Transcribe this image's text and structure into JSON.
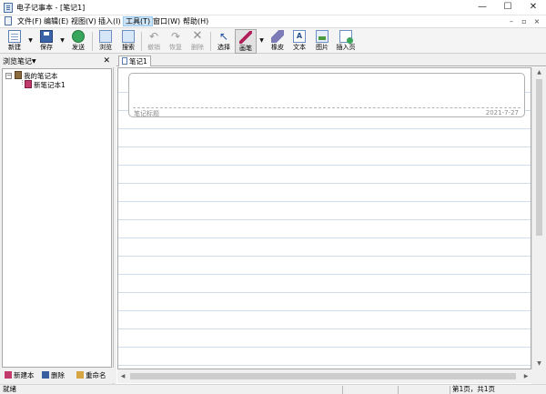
{
  "window": {
    "title": "电子记事本 - [笔记1]",
    "minimize_glyph": "—",
    "maximize_glyph": "☐",
    "close_glyph": "✕"
  },
  "menu": {
    "items": [
      "文件(F)",
      "编辑(E)",
      "视图(V)",
      "插入(I)",
      "工具(T)",
      "窗口(W)",
      "帮助(H)"
    ],
    "active": "工具(T)",
    "mdi_minimize": "–",
    "mdi_restore": "▫",
    "mdi_close": "×"
  },
  "toolbar": {
    "new_label": "新建",
    "save_label": "保存",
    "send_label": "发送",
    "browse_label": "浏览",
    "search_label": "搜索",
    "undo_label": "撤销",
    "redo_label": "恢复",
    "delete_label": "删除",
    "select_label": "选择",
    "pen_label": "画笔",
    "eraser_label": "橡皮",
    "text_label": "文本",
    "image_label": "图片",
    "insert_page_label": "插入页",
    "dropdown_glyph": "▼",
    "undo_glyph": "↶",
    "redo_glyph": "↷",
    "delete_glyph": "✕",
    "select_glyph": "↖",
    "text_glyph": "A",
    "disabled": [
      "撤销",
      "恢复",
      "删除"
    ],
    "pressed": "画笔"
  },
  "sidebar": {
    "title": "浏览笔记",
    "dropdown_glyph": "▼",
    "close_glyph": "✕",
    "tree": {
      "root_label": "我的笔记本",
      "root_toggle": "−",
      "children": [
        "新笔记本1"
      ]
    },
    "footer": {
      "new_label": "新建本",
      "delete_label": "删除",
      "rename_label": "重命名"
    }
  },
  "document": {
    "tab_label": "笔记1",
    "note_title_placeholder": "笔记标题",
    "note_date": "2021-7-27",
    "line_color": "#cfdcec"
  },
  "scroll": {
    "up_glyph": "▲",
    "down_glyph": "▼",
    "left_glyph": "◀",
    "right_glyph": "▶"
  },
  "status": {
    "text": "就绪",
    "page_info": "第1页，共1页"
  },
  "colors": {
    "menu_active_bg": "#cce4f7",
    "pen_accent": "#b0205a"
  }
}
